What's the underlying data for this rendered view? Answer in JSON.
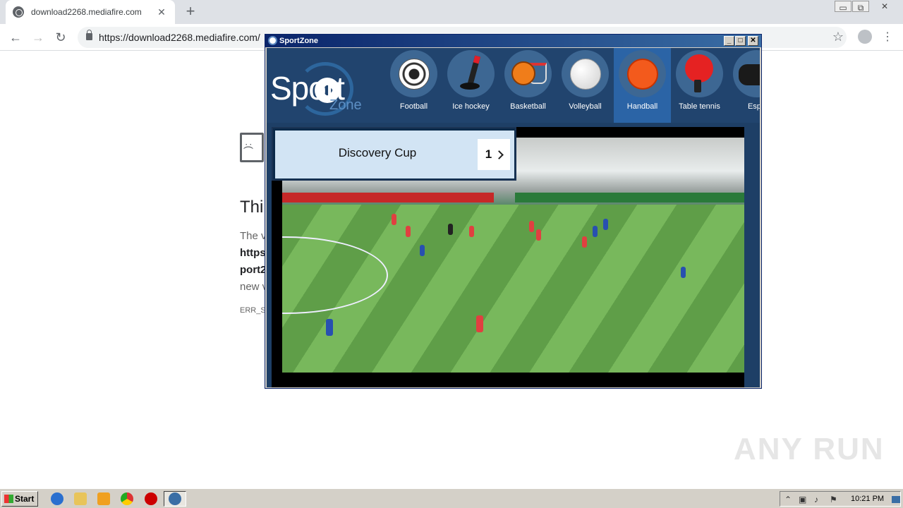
{
  "browser": {
    "tab_title": "download2268.mediafire.com",
    "tab_close": "✕",
    "new_tab": "+",
    "url": "https://download2268.mediafire.com/",
    "win_min": "▭",
    "win_max": "⧉",
    "win_close": "✕"
  },
  "error_page": {
    "title": "Thi",
    "line1": "The v",
    "line2": "https",
    "line3": "port2",
    "line4": "new v",
    "code": "ERR_S"
  },
  "sportzone": {
    "window_title": "SportZone",
    "btn_min": "_",
    "btn_max": "□",
    "btn_close": "✕",
    "logo_word": "Sport",
    "logo_sub": "Zone",
    "categories": [
      {
        "label": "Football",
        "icon": "football-icon"
      },
      {
        "label": "Ice hockey",
        "icon": "ice-hockey-icon"
      },
      {
        "label": "Basketball",
        "icon": "basketball-icon"
      },
      {
        "label": "Volleyball",
        "icon": "volleyball-icon"
      },
      {
        "label": "Handball",
        "icon": "handball-icon",
        "active": true
      },
      {
        "label": "Table tennis",
        "icon": "table-tennis-icon"
      },
      {
        "label": "Espo",
        "icon": "gamepad-icon"
      }
    ],
    "competition": {
      "name": "Discovery Cup",
      "page": "1"
    }
  },
  "watermark": "ANY RUN",
  "taskbar": {
    "start": "Start",
    "clock": "10:21 PM"
  },
  "colors": {
    "accent_active": "#2b64a6",
    "header_bg": "#21446e",
    "card_bg": "#d2e4f4"
  }
}
